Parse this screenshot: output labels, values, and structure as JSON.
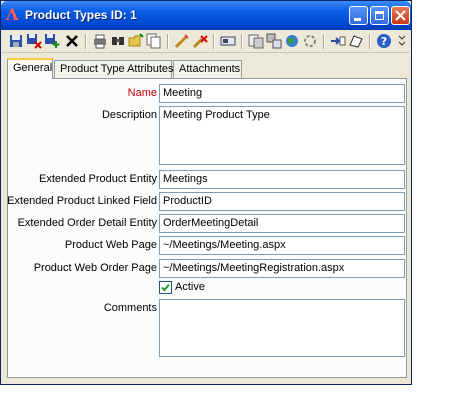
{
  "window": {
    "title": "Product Types ID: 1",
    "logo_glyph": "Λ"
  },
  "tabs": [
    {
      "label": "General",
      "active": true
    },
    {
      "label": "Product Type Attributes",
      "active": false
    },
    {
      "label": "Attachments",
      "active": false
    }
  ],
  "form": {
    "name": {
      "label": "Name",
      "value": "Meeting"
    },
    "description": {
      "label": "Description",
      "value": "Meeting Product Type"
    },
    "extended_entity": {
      "label": "Extended Product Entity",
      "value": "Meetings"
    },
    "linked_field": {
      "label": "Extended Product Linked Field",
      "value": "ProductID"
    },
    "order_detail_entity": {
      "label": "Extended Order Detail Entity",
      "value": "OrderMeetingDetail"
    },
    "web_page": {
      "label": "Product Web Page",
      "value": "~/Meetings/Meeting.aspx"
    },
    "web_order_page": {
      "label": "Product Web Order Page",
      "value": "~/Meetings/MeetingRegistration.aspx"
    },
    "active": {
      "label": "Active",
      "checked": true
    },
    "comments": {
      "label": "Comments",
      "value": ""
    }
  },
  "toolbar_icons": [
    "save-icon",
    "save-close-icon",
    "save-new-icon",
    "delete-icon",
    "print-icon",
    "find-icon",
    "open-folder-icon",
    "copy-icon",
    "spell-check-icon",
    "clear-icon",
    "form-icon",
    "report-icon",
    "link-icon",
    "web-icon",
    "refresh-icon",
    "attach-icon",
    "note-icon",
    "help-icon"
  ],
  "colors": {
    "required_label": "#d10000",
    "titlebar": "#0047d1"
  }
}
